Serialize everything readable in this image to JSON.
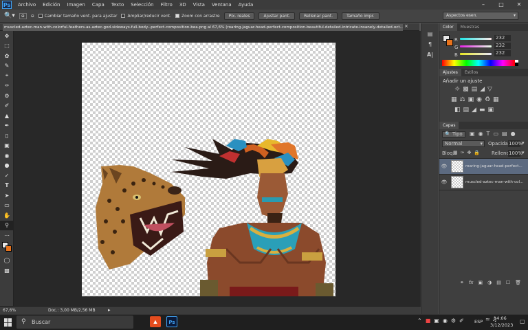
{
  "app": {
    "logo": "Ps"
  },
  "menu": [
    "Archivo",
    "Edición",
    "Imagen",
    "Capa",
    "Texto",
    "Selección",
    "Filtro",
    "3D",
    "Vista",
    "Ventana",
    "Ayuda"
  ],
  "window_controls": {
    "minimize": "–",
    "maximize": "□",
    "close": "✕"
  },
  "options_bar": {
    "resize_windows": "Cambiar tamaño vent. para ajustar",
    "zoom_all": "Ampliar/reducir vent.",
    "scrubby_zoom": "Zoom con arrastre",
    "btn_actual": "Píx. reales",
    "btn_fit": "Ajustar pant.",
    "btn_fill": "Rellenar pant.",
    "btn_print": "Tamaño impr.",
    "workspace": "Aspectos esen."
  },
  "doc_tab": {
    "title": "muscled-aztec-man-with-colorful-feathers-as-aztec-god-sideways-full-body--perfect-composition-bea.png al 67,6% (roaring-jaguar-head-perfect-composition-beautiful-detailed-intricate-insanely-detailed-oct...",
    "close": "×"
  },
  "status": {
    "zoom": "67,6%",
    "doc": "Doc.: 3,00 MB/2,56 MB"
  },
  "color_panel": {
    "tabs": [
      "Color",
      "Muestras"
    ],
    "r_label": "R",
    "r_value": "232",
    "g_label": "G",
    "g_value": "232",
    "b_label": "B",
    "b_value": "232",
    "foreground": "#e8e8e8",
    "background": "#e8731c"
  },
  "adjust_panel": {
    "tabs": [
      "Ajustes",
      "Estilos"
    ],
    "title": "Añadir un ajuste"
  },
  "layers_panel": {
    "tab": "Capas",
    "filter": "Tipo",
    "blend": "Normal",
    "opacity_label": "Opacidad:",
    "opacity": "100%",
    "lock_label": "Bloq.:",
    "fill_label": "Relleno:",
    "fill": "100%",
    "layers": [
      {
        "name": "roaring-jaguar-head-perfect...",
        "selected": true
      },
      {
        "name": "muscled-aztec-man-with-col...",
        "selected": false
      }
    ]
  },
  "taskbar": {
    "search": "Buscar",
    "lang": "ESP",
    "time": "14:06",
    "date": "3/12/2023"
  }
}
